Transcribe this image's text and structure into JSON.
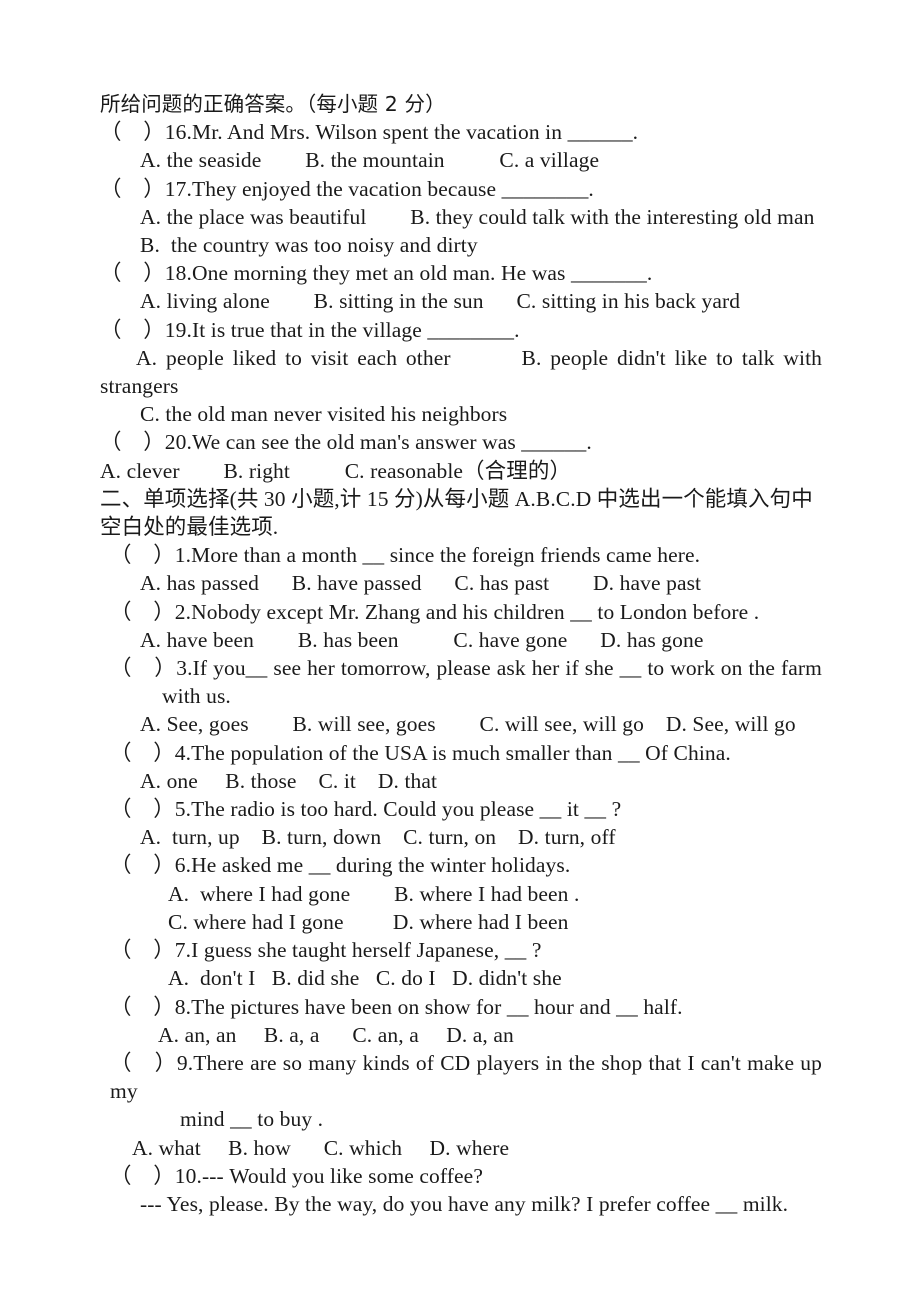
{
  "document": {
    "type": "exam-worksheet",
    "language": "zh-CN + en",
    "page_background": "#ffffff",
    "text_color": "#1a1a1a"
  },
  "reading_section": {
    "instruction_tail": "所给问题的正确答案。（每小题 2 分）",
    "questions": [
      {
        "marker": "（　）16.",
        "stem": "Mr. And Mrs. Wilson spent the vacation in ______.",
        "option_lines": [
          "A. the seaside        B. the mountain          C. a village"
        ]
      },
      {
        "marker": "（　）17.",
        "stem": "They enjoyed the vacation because ________.",
        "option_lines": [
          "A. the place was beautiful        B. they could talk with the interesting old man",
          "B.  the country was too noisy and dirty"
        ]
      },
      {
        "marker": "（　）18.",
        "stem": "One morning they met an old man. He was _______.",
        "option_lines": [
          "A. living alone        B. sitting in the sun      C. sitting in his back yard"
        ]
      },
      {
        "marker": "（　）19.",
        "stem": "It is true that in the village ________.",
        "option_justified": "A. people liked to visit each other        B. people didn't like to talk with",
        "option_wrap": "strangers",
        "option_lines": [
          "C. the old man never visited his neighbors"
        ]
      },
      {
        "marker": "（　）20.",
        "stem": "We can see the old man's answer was ______.",
        "option_lines": [
          "A. clever        B. right          C. reasonable（合理的）"
        ]
      }
    ]
  },
  "choice_section": {
    "heading_line1": "二、单项选择(共 30 小题,计 15 分)从每小题 A.B.C.D 中选出一个能填入句中",
    "heading_line2": "空白处的最佳选项.",
    "questions": [
      {
        "marker": "（　）1.",
        "stem": "More than a month __ since the foreign friends came here.",
        "option_lines": [
          "A. has passed      B. have passed      C. has past        D. have past"
        ]
      },
      {
        "marker": "（　）2.",
        "stem": "Nobody except Mr. Zhang and his children __ to London before .",
        "option_lines": [
          "A. have been        B. has been          C. have gone      D. has gone"
        ]
      },
      {
        "marker": "（　）3.",
        "stem_justified": "If you__ see her tomorrow, please ask her if she __ to work on the farm",
        "stem_wrap": "with us.",
        "option_lines": [
          "A. See, goes        B. will see, goes        C. will see, will go    D. See, will go"
        ]
      },
      {
        "marker": "（　）4.",
        "stem": "The population of the USA is much smaller than __ Of China.",
        "option_lines": [
          "A. one     B. those    C. it    D. that"
        ]
      },
      {
        "marker": "（　）5.",
        "stem": "The radio is too hard. Could you please __ it __ ?",
        "option_lines": [
          "A.  turn, up    B. turn, down    C. turn, on    D. turn, off"
        ]
      },
      {
        "marker": "（　）6.",
        "stem": "He asked me __ during the winter holidays.",
        "option_lines": [
          "A.  where I had gone        B. where I had been .",
          "C. where had I gone         D. where had I been"
        ]
      },
      {
        "marker": "（　）7.",
        "stem": "I guess she taught herself Japanese, __ ?",
        "option_lines": [
          "A.  don't I   B. did she   C. do I   D. didn't she"
        ]
      },
      {
        "marker": "（　）8.",
        "stem": "The pictures have been on show for __ hour and __ half.",
        "option_lines": [
          "A. an, an     B. a, a      C. an, a     D. a, an"
        ]
      },
      {
        "marker": "（　）9.",
        "stem_justified": "There are so many kinds of CD players in the shop that I can't make up my",
        "stem_wrap": "mind __ to buy .",
        "option_lines": [
          "A. what     B. how      C. which     D. where"
        ]
      },
      {
        "marker": "（　）10.",
        "stem": "--- Would you like some coffee?",
        "dialogue_reply": "--- Yes, please. By the way, do you have any milk? I prefer coffee __ milk."
      }
    ]
  }
}
